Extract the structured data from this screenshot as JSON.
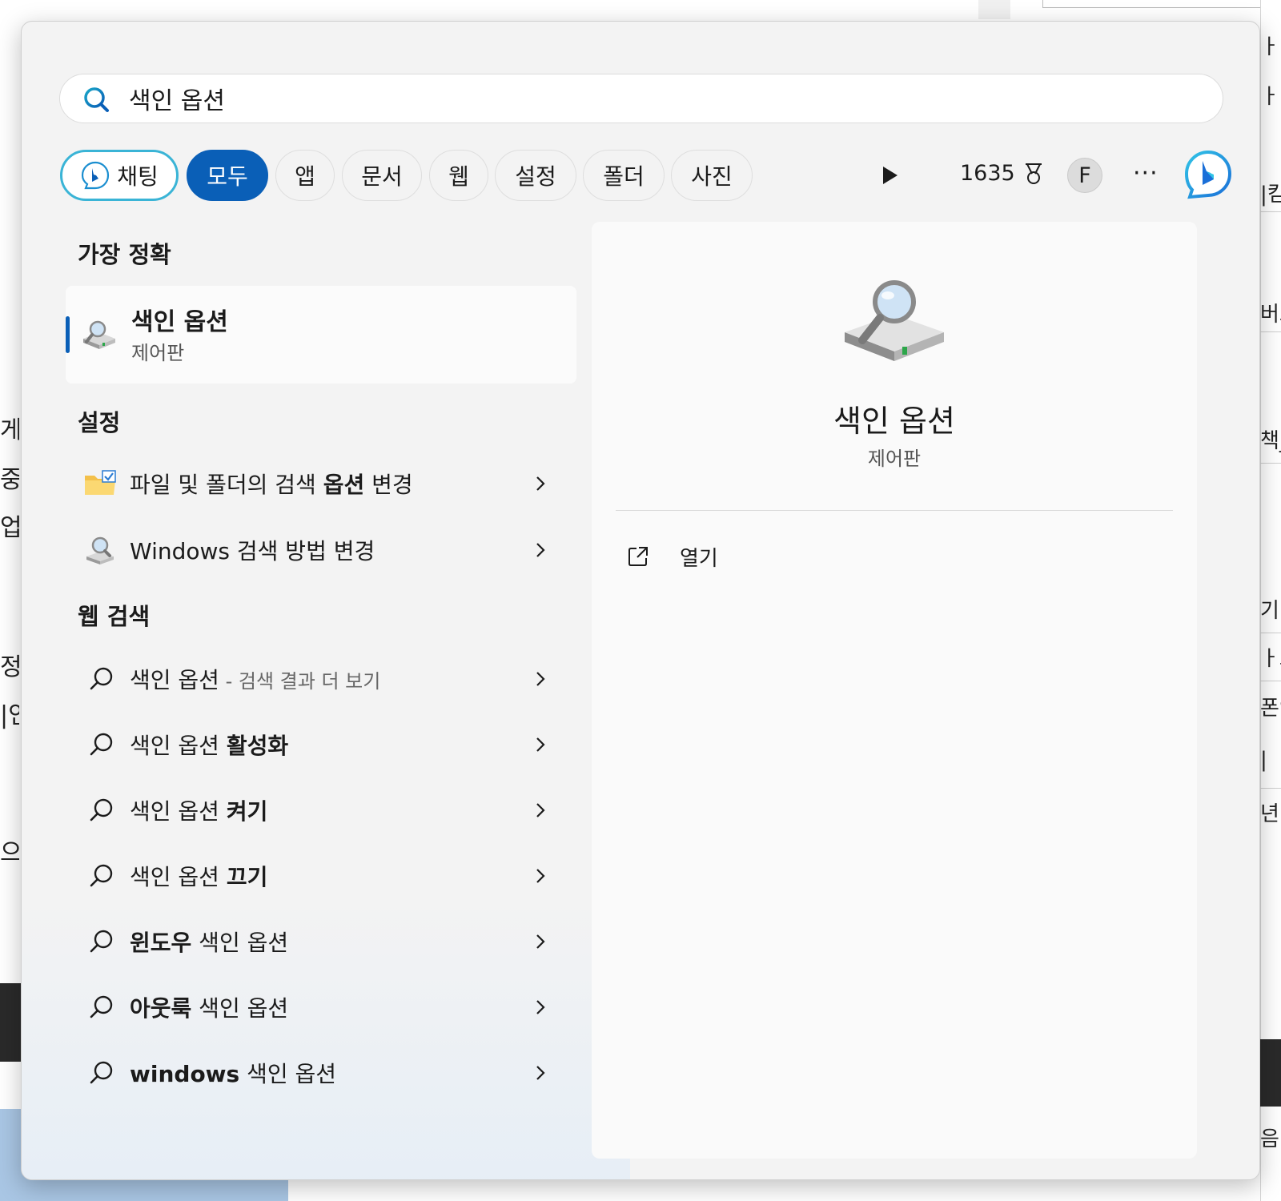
{
  "background": {
    "left_fragments": [
      "게",
      "중",
      "업",
      "정",
      "|인",
      "으"
    ],
    "right_fragments": [
      "ㅏ",
      "ㅏ",
      "|킴",
      "버고",
      "책_",
      "기",
      "ㅏ드",
      "폰인",
      "|",
      "년",
      "음"
    ]
  },
  "search": {
    "query": "색인 옵션",
    "icon": "search-icon"
  },
  "filters": {
    "chat_label": "채팅",
    "chips": [
      "모두",
      "앱",
      "문서",
      "웹",
      "설정",
      "폴더",
      "사진"
    ],
    "active": "모두",
    "points": "1635",
    "avatar_initial": "F",
    "more_label": "···"
  },
  "best_match": {
    "heading": "가장 정확",
    "title": "색인 옵션",
    "subtitle": "제어판",
    "icon": "indexing-options-icon"
  },
  "settings": {
    "heading": "설정",
    "items": [
      {
        "pre": "파일 및 폴더의 검색 ",
        "bold": "옵션",
        "post": " 변경",
        "icon": "folder-options-icon"
      },
      {
        "pre": "Windows 검색 방법 변경",
        "bold": "",
        "post": "",
        "icon": "search-settings-icon"
      }
    ]
  },
  "web": {
    "heading": "웹 검색",
    "items": [
      {
        "pre": "색인 옵션",
        "bold": "",
        "muted": " - 검색 결과 더 보기"
      },
      {
        "pre": "색인 옵션 ",
        "bold": "활성화",
        "muted": ""
      },
      {
        "pre": "색인 옵션 ",
        "bold": "켜기",
        "muted": ""
      },
      {
        "pre": "색인 옵션 ",
        "bold": "끄기",
        "muted": ""
      },
      {
        "pre": "",
        "bold": "윈도우",
        "post": " 색인 옵션",
        "muted": ""
      },
      {
        "pre": "",
        "bold": "아웃룩",
        "post": " 색인 옵션",
        "muted": ""
      },
      {
        "pre": "",
        "bold": "windows",
        "post": " 색인 옵션",
        "muted": ""
      }
    ]
  },
  "preview": {
    "title": "색인 옵션",
    "subtitle": "제어판",
    "open_label": "열기",
    "icon": "indexing-options-icon"
  },
  "colors": {
    "accent": "#0a5fb7",
    "chat_border": "#3ab4d6",
    "panel_bg": "#f3f3f3"
  }
}
